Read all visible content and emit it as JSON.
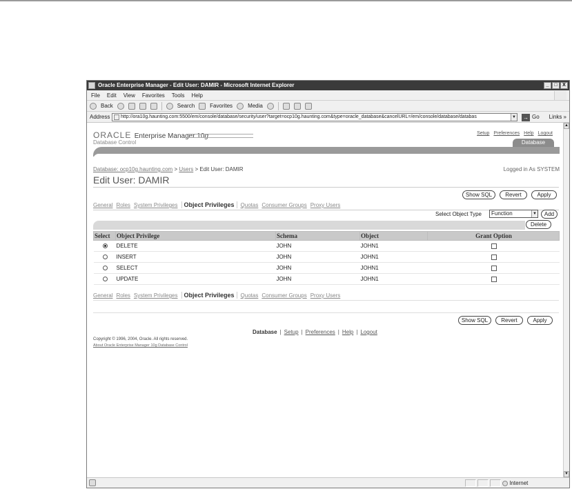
{
  "window": {
    "title": "Oracle Enterprise Manager - Edit User: DAMIR - Microsoft Internet Explorer",
    "buttons": [
      "_",
      "□",
      "X"
    ]
  },
  "menu": [
    "File",
    "Edit",
    "View",
    "Favorites",
    "Tools",
    "Help"
  ],
  "toolbar": {
    "back": "Back",
    "search": "Search",
    "favorites": "Favorites",
    "media": "Media"
  },
  "address": {
    "label": "Address",
    "url": "http://ora10g.haunting.com:5500/em/console/database/security/user?target=ocp10g.haunting.com&type=oracle_database&cancelURL=/em/console/database/databas",
    "go": "Go",
    "links": "Links »"
  },
  "em": {
    "brand": "ORACLE",
    "product": "Enterprise Manager 10",
    "product_g": "g",
    "subproduct": "Database Control",
    "global_links": [
      "Setup",
      "Preferences",
      "Help",
      "Logout"
    ],
    "tab": "Database",
    "breadcrumb": {
      "db": "Database: ocp10g.haunting.com",
      "sep1": ">",
      "users": "Users",
      "sep2": ">",
      "current": "Edit User: DAMIR"
    },
    "logged_in": "Logged in As SYSTEM",
    "title": "Edit User: DAMIR",
    "actions": {
      "show_sql": "Show SQL",
      "revert": "Revert",
      "apply": "Apply"
    },
    "subtabs": [
      "General",
      "Roles",
      "System Privileges",
      "Object Privileges",
      "Quotas",
      "Consumer Groups",
      "Proxy Users"
    ],
    "active_subtab": "Object Privileges",
    "select_object_type_label": "Select Object Type",
    "select_object_type_value": "Function",
    "add": "Add",
    "delete": "Delete",
    "table": {
      "headers": [
        "Select",
        "Object Privilege",
        "Schema",
        "Object",
        "Grant Option"
      ],
      "rows": [
        {
          "privilege": "DELETE",
          "schema": "JOHN",
          "object": "JOHN1",
          "selected": true
        },
        {
          "privilege": "INSERT",
          "schema": "JOHN",
          "object": "JOHN1",
          "selected": false
        },
        {
          "privilege": "SELECT",
          "schema": "JOHN",
          "object": "JOHN1",
          "selected": false
        },
        {
          "privilege": "UPDATE",
          "schema": "JOHN",
          "object": "JOHN1",
          "selected": false
        }
      ]
    },
    "footer": {
      "database": "Database",
      "setup": "Setup",
      "preferences": "Preferences",
      "help": "Help",
      "logout": "Logout",
      "sep": "|",
      "copyright": "Copyright © 1996, 2004, Oracle. All rights reserved.",
      "about": "About Oracle Enterprise Manager 10g Database Control"
    }
  },
  "status": {
    "zone": "Internet"
  }
}
